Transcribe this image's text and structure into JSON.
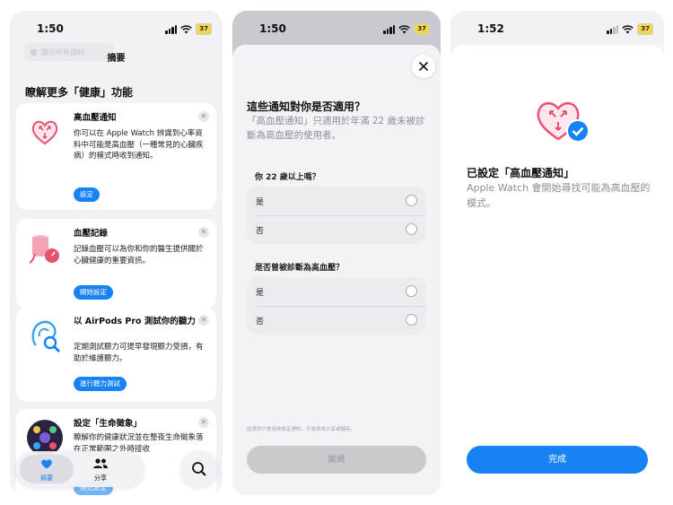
{
  "colors": {
    "accent": "#1682f4",
    "heart": "#e8516f",
    "background": "#f2f2f7"
  },
  "screens": [
    {
      "status": {
        "time": "1:50",
        "battery": "37"
      },
      "nav": {
        "title": "摘要",
        "blurred_text": "顯示所有資料"
      },
      "section_title": "瞭解更多「健康」功能",
      "cards": [
        {
          "title": "高血壓通知",
          "body": "你可以在 Apple Watch 辨識到心率資料中可能是高血壓（一種常見的心臟疾病）的模式時收到通知。",
          "button": "設定",
          "icon": "heart-arrows-icon"
        },
        {
          "title": "血壓記錄",
          "body": "記錄血壓可以為你和你的醫生提供關於心臟健康的重要資訊。",
          "button": "開始設定",
          "icon": "blood-pressure-cuff-icon"
        },
        {
          "title": "以 AirPods Pro 測試你的聽力",
          "body": "定期測試聽力可提早發現聽力受損，有助於維護聽力。",
          "button": "進行聽力測試",
          "icon": "ear-search-icon"
        },
        {
          "title": "設定「生命徵象」",
          "body": "瞭解你的健康狀況並在整夜生命徵象落在正常範圍之外時接收",
          "button": "開始設定",
          "icon": "vitals-icon"
        }
      ],
      "tabs": [
        {
          "label": "摘要",
          "icon": "heart-icon",
          "active": true
        },
        {
          "label": "分享",
          "icon": "people-icon",
          "active": false
        }
      ]
    },
    {
      "status": {
        "time": "1:50",
        "battery": "37"
      },
      "title": "這些通知對你是否適用？",
      "subtitle": "「高血壓通知」只適用於年滿 22 歲未被診斷為高血壓的使用者。",
      "questions": [
        {
          "label": "你 22 歲以上嗎？",
          "options": [
            "是",
            "否"
          ]
        },
        {
          "label": "是否曾被診斷為高血壓？",
          "options": [
            "是",
            "否"
          ]
        }
      ],
      "footnote": "此資訊只會用來設定通知，不會用來分享或儲存。",
      "continue_label": "繼續"
    },
    {
      "status": {
        "time": "1:52",
        "battery": "37"
      },
      "title": "已設定「高血壓通知」",
      "subtitle": "Apple Watch 會開始尋找可能為高血壓的模式。",
      "done_label": "完成"
    }
  ]
}
